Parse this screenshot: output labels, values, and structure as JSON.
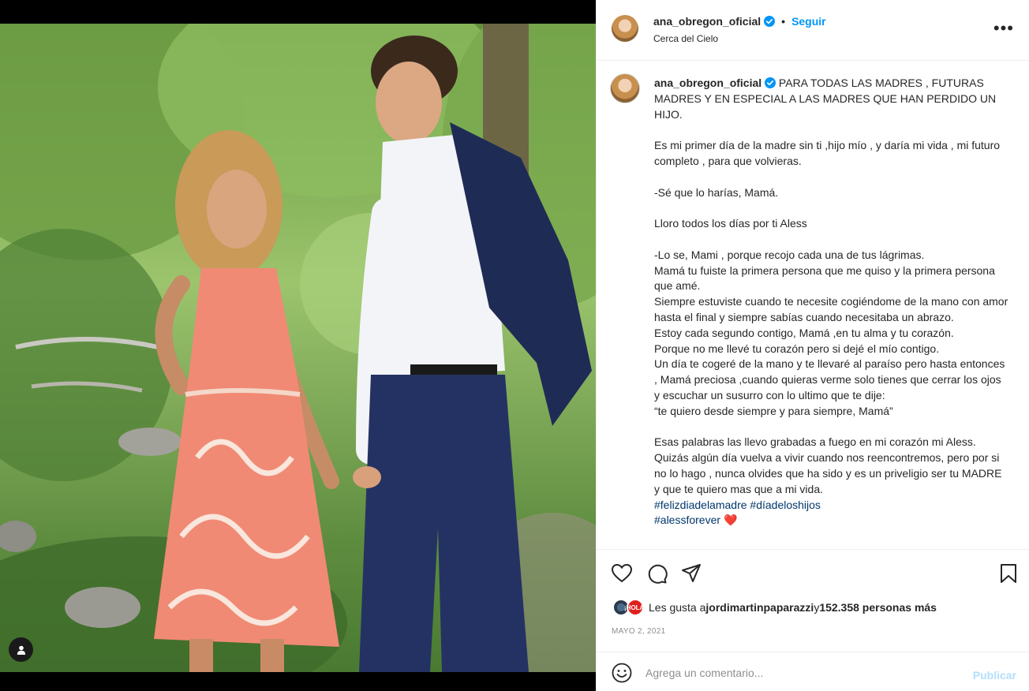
{
  "header": {
    "username": "ana_obregon_oficial",
    "separator": "•",
    "follow_label": "Seguir",
    "location": "Cerca del Cielo",
    "more_label": "•••"
  },
  "caption": {
    "username": "ana_obregon_oficial",
    "text": " PARA TODAS LAS MADRES , FUTURAS MADRES Y EN ESPECIAL A LAS MADRES QUE HAN PERDIDO UN HIJO.\n\nEs mi primer día de la madre sin ti ,hijo mío , y daría mi vida , mi futuro completo , para que volvieras.\n\n-Sé que lo harías, Mamá.\n\nLloro todos los días por ti Aless\n\n-Lo se, Mami , porque recojo cada una de tus lágrimas.\nMamá tu fuiste la primera persona que me quiso y la primera persona que amé.\nSiempre estuviste cuando te necesite cogiéndome de la mano con amor hasta el final y siempre sabías cuando necesitaba un abrazo.\nEstoy cada segundo contigo, Mamá ,en tu alma y tu corazón.\nPorque no me llevé tu corazón pero si dejé el mío contigo.\nUn día te cogeré de la mano y te llevaré al paraíso pero hasta entonces , Mamá preciosa ,cuando quieras verme solo tienes que cerrar los ojos y escuchar un susurro con lo ultimo que te dije:\n“te quiero desde siempre y para siempre, Mamá”\n\nEsas palabras las llevo grabadas a fuego en mi corazón mi Aless.\nQuizás algún día vuelva a vivir cuando nos reencontremos, pero por si no lo hago , nunca olvides que ha sido y es un priveligio ser tu MADRE y que te quiero mas que a mi vida.\n",
    "hashtag1": "#felizdiadelamadre",
    "hashtag2": "#díadeloshijos",
    "hashtag3": "#alessforever",
    "heart_emoji": "❤️"
  },
  "likes": {
    "prefix": "Les gusta a ",
    "user": "jordimartinpaparazzi",
    "middle": " y ",
    "count": "152.358 personas más",
    "avatar2_text": "¡HOLA!"
  },
  "date": "MAYO 2, 2021",
  "comment": {
    "placeholder": "Agrega un comentario...",
    "publish_label": "Publicar"
  },
  "colors": {
    "accent": "#0095f6",
    "hashtag": "#00376b",
    "publish_disabled": "#b2dffc",
    "muted": "#8e8e8e"
  },
  "icons": {
    "verified": "verified-badge-icon",
    "like": "heart-icon",
    "comment": "comment-bubble-icon",
    "share": "paper-plane-icon",
    "save": "bookmark-icon",
    "emoji": "smiley-icon",
    "tag": "user-tag-icon"
  }
}
